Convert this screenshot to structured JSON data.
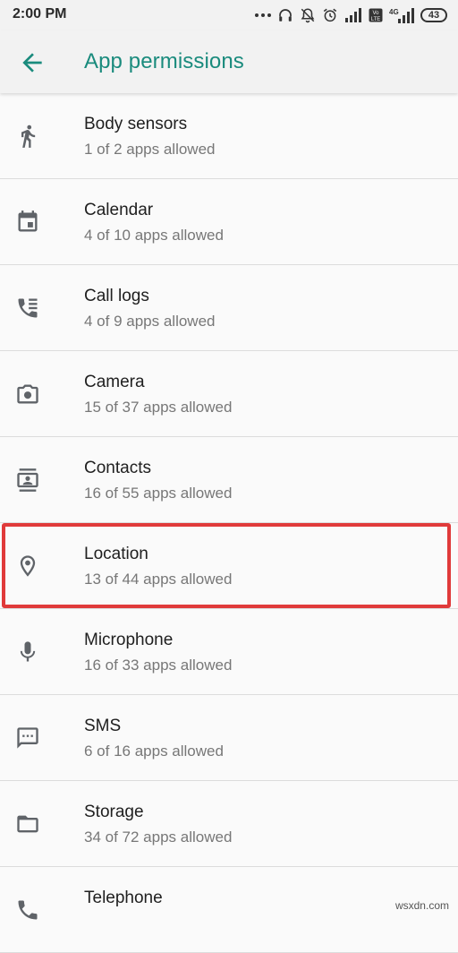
{
  "status_bar": {
    "time": "2:00 PM",
    "battery": "43",
    "icons": [
      "more-dots-icon",
      "headphones-icon",
      "mute-icon",
      "alarm-icon",
      "signal-icon",
      "volte-icon",
      "signal-4g-icon",
      "battery-icon"
    ]
  },
  "app_bar": {
    "back_icon": "arrow-back-icon",
    "title": "App permissions"
  },
  "permissions": [
    {
      "label": "Body sensors",
      "summary": "1 of 2 apps allowed",
      "icon": "body-sensors-icon"
    },
    {
      "label": "Calendar",
      "summary": "4 of 10 apps allowed",
      "icon": "calendar-icon"
    },
    {
      "label": "Call logs",
      "summary": "4 of 9 apps allowed",
      "icon": "call-log-icon"
    },
    {
      "label": "Camera",
      "summary": "15 of 37 apps allowed",
      "icon": "camera-icon"
    },
    {
      "label": "Contacts",
      "summary": "16 of 55 apps allowed",
      "icon": "contacts-icon"
    },
    {
      "label": "Location",
      "summary": "13 of 44 apps allowed",
      "icon": "location-icon"
    },
    {
      "label": "Microphone",
      "summary": "16 of 33 apps allowed",
      "icon": "microphone-icon"
    },
    {
      "label": "SMS",
      "summary": "6 of 16 apps allowed",
      "icon": "sms-icon"
    },
    {
      "label": "Storage",
      "summary": "34 of 72 apps allowed",
      "icon": "folder-icon"
    },
    {
      "label": "Telephone",
      "summary": "",
      "icon": "phone-icon"
    }
  ],
  "highlighted_item": "Location",
  "watermark": "wsxdn.com",
  "colors": {
    "accent": "#1a8b7d",
    "highlight": "#e03a3a",
    "background": "#fafafa",
    "bar": "#f2f2f2"
  }
}
